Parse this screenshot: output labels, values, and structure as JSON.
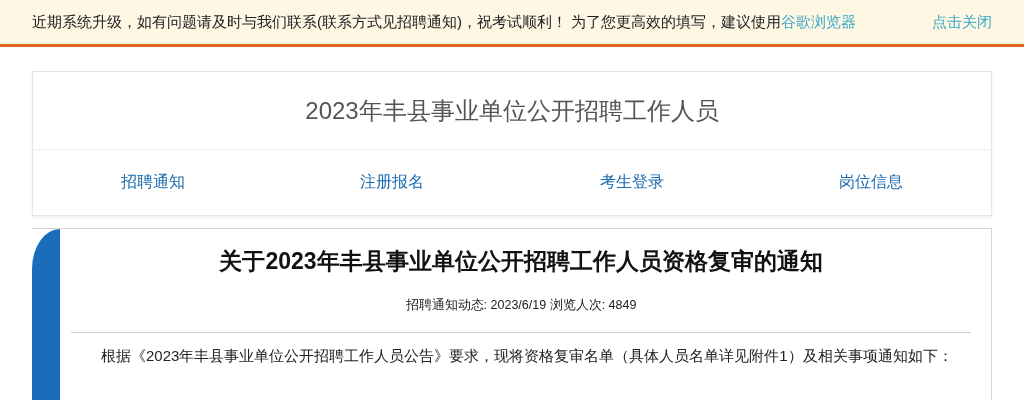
{
  "notice": {
    "text": "近期系统升级，如有问题请及时与我们联系(联系方式见招聘通知)，祝考试顺利！ 为了您更高效的填写，建议使用",
    "link": "谷歌浏览器",
    "close": "点击关闭"
  },
  "header": {
    "title": "2023年丰县事业单位公开招聘工作人员",
    "nav": [
      {
        "label": "招聘通知"
      },
      {
        "label": "注册报名"
      },
      {
        "label": "考生登录"
      },
      {
        "label": "岗位信息"
      }
    ]
  },
  "article": {
    "title": "关于2023年丰县事业单位公开招聘工作人员资格复审的通知",
    "meta": "招聘通知动态: 2023/6/19 浏览人次: 4849",
    "body": "根据《2023年丰县事业单位公开招聘工作人员公告》要求，现将资格复审名单（具体人员名单详见附件1）及相关事项通知如下："
  }
}
